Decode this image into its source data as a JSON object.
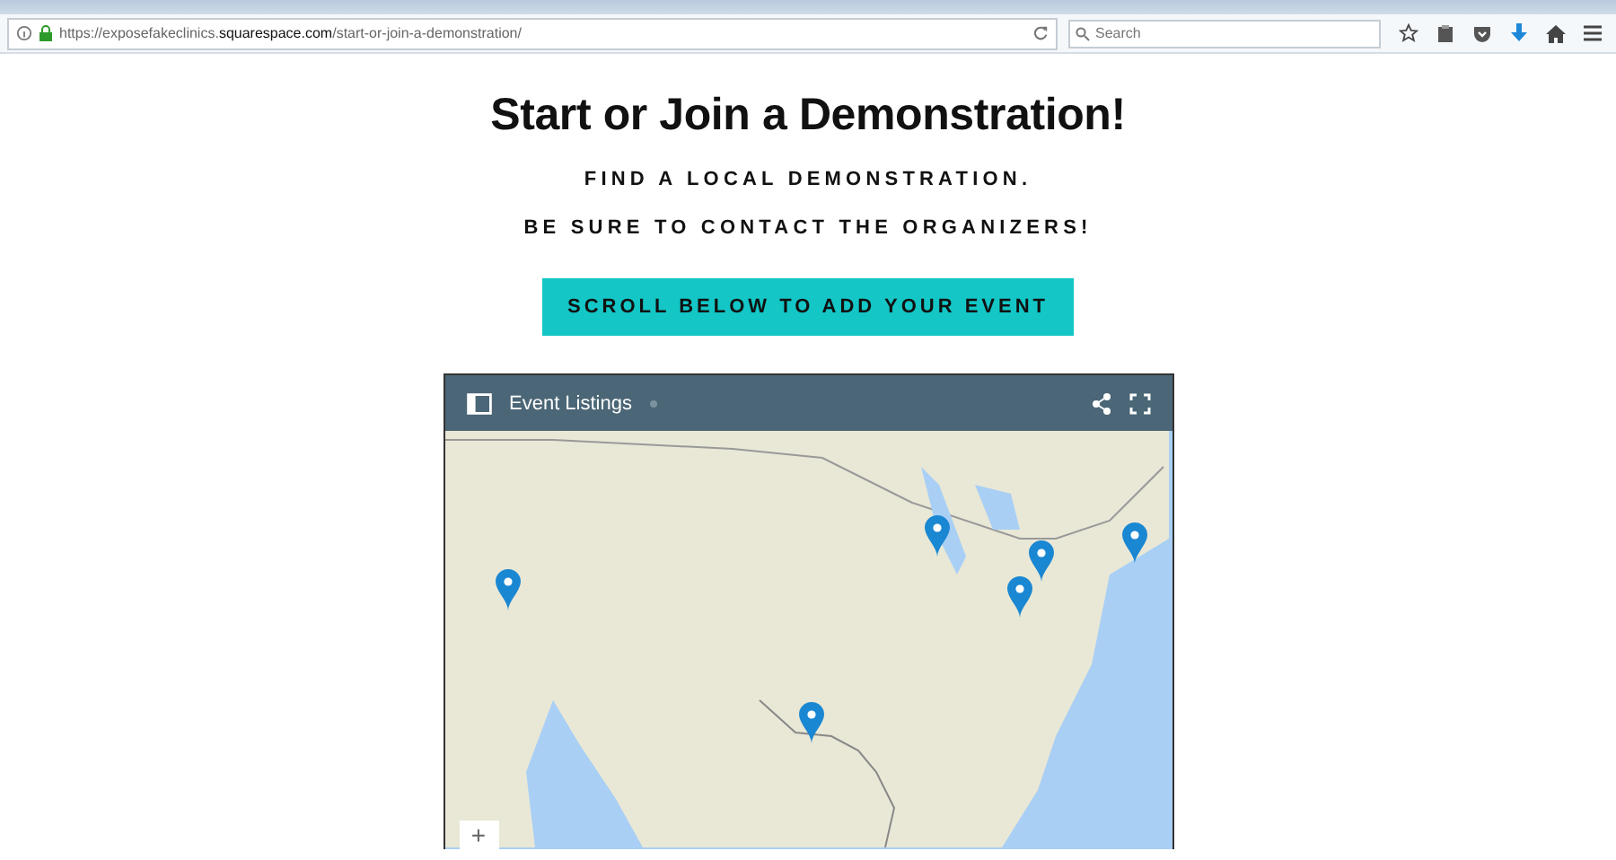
{
  "browser": {
    "url": "https://exposefakeclinics.**squarespace.com**/start-or-join-a-demonstration/",
    "search": {
      "placeholder": "Search"
    }
  },
  "page": {
    "title": "Start or Join a Demonstration!",
    "subtitles": [
      "FIND A LOCAL DEMONSTRATION.",
      "BE SURE TO CONTACT THE ORGANIZERS!"
    ],
    "button": "SCROLL BELOW TO ADD YOUR EVENT"
  },
  "map": {
    "title": "Event Listings",
    "zoom_in": "+"
  }
}
